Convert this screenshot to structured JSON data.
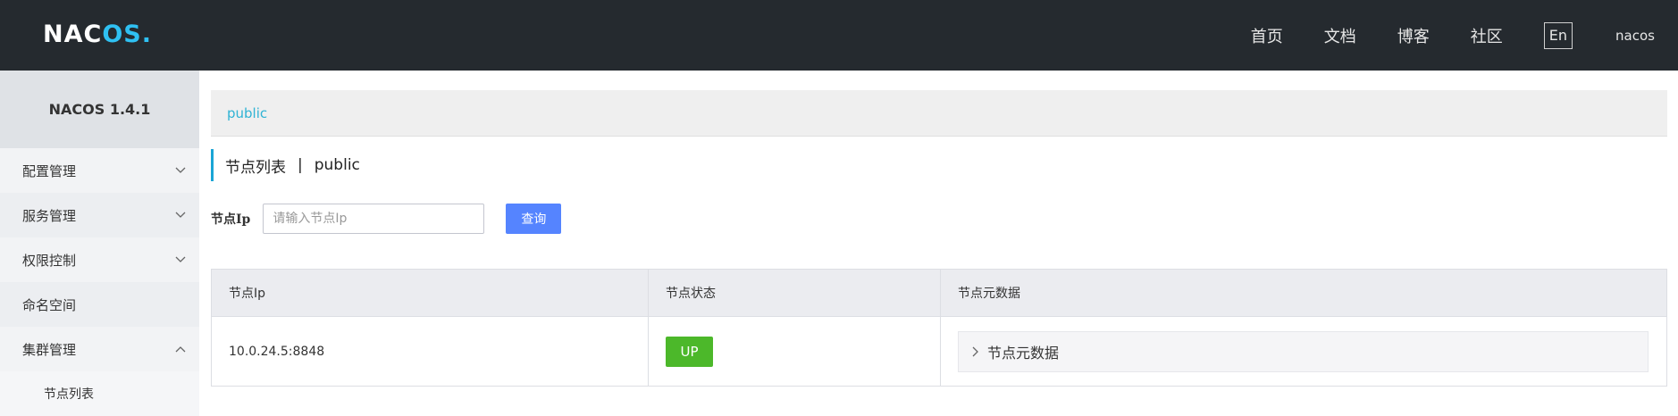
{
  "header": {
    "logo_text_a": "NAC",
    "logo_text_b": "OS",
    "logo_dot": ".",
    "nav": [
      "首页",
      "文档",
      "博客",
      "社区"
    ],
    "lang": "En",
    "user": "nacos"
  },
  "sidebar": {
    "title": "NACOS 1.4.1",
    "items": [
      {
        "label": "配置管理",
        "icon": "chevron-down-icon"
      },
      {
        "label": "服务管理",
        "icon": "chevron-down-icon"
      },
      {
        "label": "权限控制",
        "icon": "chevron-down-icon"
      },
      {
        "label": "命名空间"
      },
      {
        "label": "集群管理",
        "icon": "chevron-up-icon"
      }
    ],
    "subitems": [
      "节点列表"
    ]
  },
  "main": {
    "breadcrumb": "public",
    "title": "节点列表",
    "title_sep": "|",
    "title_ns": "public",
    "filter": {
      "label": "节点Ip",
      "placeholder": "请输入节点Ip",
      "value": "",
      "button": "查询"
    },
    "table": {
      "columns": [
        "节点Ip",
        "节点状态",
        "节点元数据"
      ],
      "rows": [
        {
          "ip": "10.0.24.5:8848",
          "status": "UP",
          "meta": "节点元数据"
        }
      ]
    }
  },
  "colors": {
    "topbar": "#252a2f",
    "accent": "#2fc0f2",
    "primary_button": "#5584ff",
    "status_up": "#4cb82a",
    "link": "#2fb3d4"
  }
}
